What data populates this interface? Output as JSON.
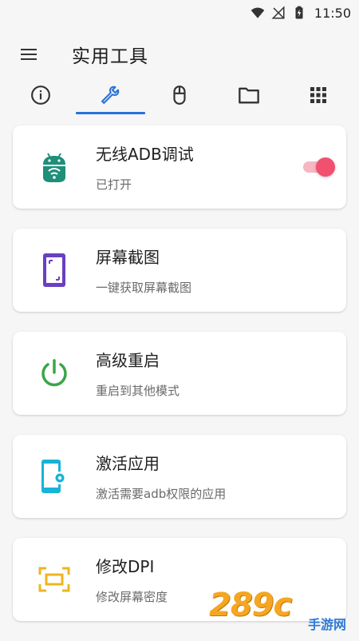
{
  "status_bar": {
    "time": "11:50",
    "icons": [
      "wifi-icon",
      "signal-off-icon",
      "battery-charging-icon"
    ]
  },
  "app_bar": {
    "menu_icon": "hamburger-menu-icon",
    "title": "实用工具"
  },
  "tabs": [
    {
      "icon": "info-icon",
      "active": false
    },
    {
      "icon": "wrench-icon",
      "active": true
    },
    {
      "icon": "mouse-icon",
      "active": false
    },
    {
      "icon": "folder-icon",
      "active": false
    },
    {
      "icon": "apps-grid-icon",
      "active": false
    }
  ],
  "tools": [
    {
      "title": "无线ADB调试",
      "subtitle": "已打开",
      "icon": "android-wifi-icon",
      "icon_color": "#1e8f78",
      "toggle_on": true
    },
    {
      "title": "屏幕截图",
      "subtitle": "一键获取屏幕截图",
      "icon": "screenshot-icon",
      "icon_color": "#6a3fc1"
    },
    {
      "title": "高级重启",
      "subtitle": "重启到其他模式",
      "icon": "power-icon",
      "icon_color": "#3aa648"
    },
    {
      "title": "激活应用",
      "subtitle": "激活需要adb权限的应用",
      "icon": "phone-settings-icon",
      "icon_color": "#18b3d6"
    },
    {
      "title": "修改DPI",
      "subtitle": "修改屏幕密度",
      "icon": "dpi-frame-icon",
      "icon_color": "#f0b51c"
    }
  ],
  "colors": {
    "accent": "#2a72d9",
    "toggle_thumb": "#f2506f",
    "toggle_track": "#f6b6c2"
  },
  "watermark": {
    "text": "289",
    "suffix": "c",
    "sub": "手游网"
  }
}
